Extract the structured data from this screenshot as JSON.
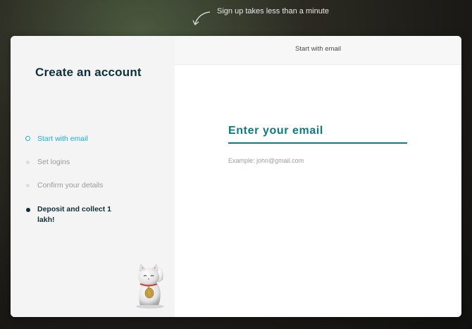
{
  "hint": {
    "text": "Sign up takes less than a minute",
    "icon": "curved-arrow-icon"
  },
  "left_panel": {
    "title": "Create an account",
    "steps": [
      {
        "label": "Start with email",
        "state": "active"
      },
      {
        "label": "Set logins",
        "state": "inactive"
      },
      {
        "label": "Confirm your details",
        "state": "inactive"
      },
      {
        "label": "Deposit and collect 1 lakh!",
        "state": "highlight"
      }
    ],
    "mascot_icon": "lucky-cat-icon"
  },
  "right_panel": {
    "header": "Start with email",
    "email": {
      "placeholder": "Enter your email",
      "value": ""
    },
    "example": "Example: john@gmail.com"
  },
  "colors": {
    "accent": "#1aaed6",
    "input": "#0e7a84",
    "title": "#0f2f3a"
  }
}
